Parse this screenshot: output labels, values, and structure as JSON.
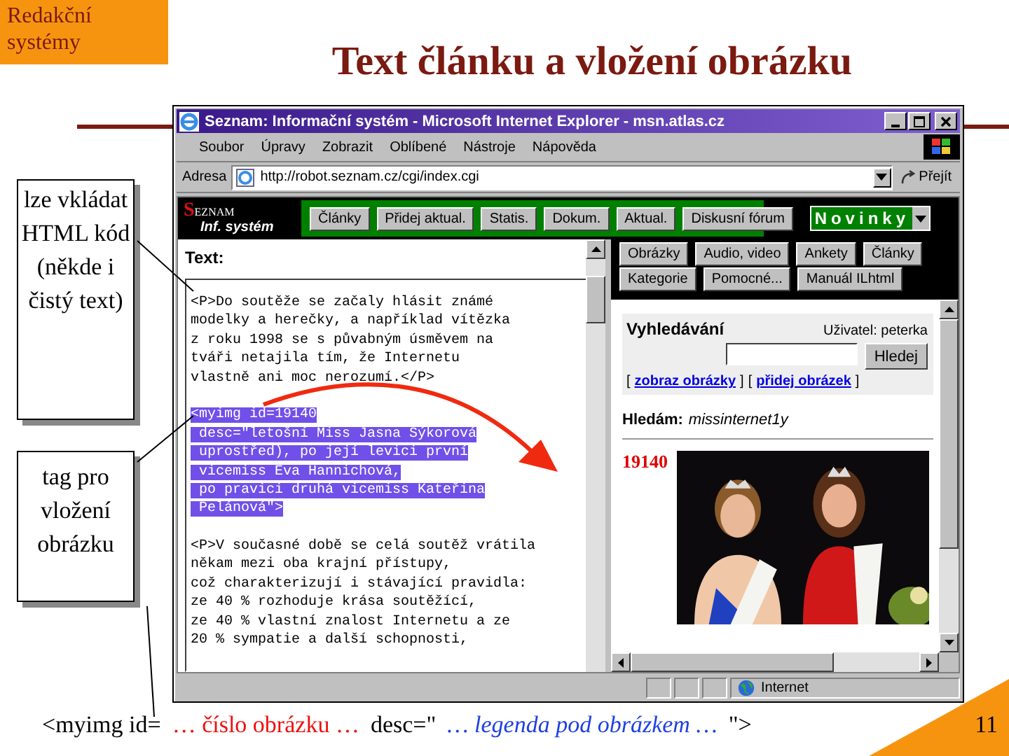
{
  "slide": {
    "corner_label": "Redakční systémy",
    "title": "Text článku a vložení obrázku",
    "page_number": "11"
  },
  "callouts": [
    {
      "text": "lze vkládat HTML kód (někde i čistý text)"
    },
    {
      "text": "tag pro vložení obrázku"
    }
  ],
  "browser": {
    "title": "Seznam: Informační systém - Microsoft Internet Explorer - msn.atlas.cz",
    "menu": [
      "Soubor",
      "Úpravy",
      "Zobrazit",
      "Oblíbené",
      "Nástroje",
      "Nápověda"
    ],
    "address_label": "Adresa",
    "address": "http://robot.seznam.cz/cgi/index.cgi",
    "go_button": "Přejít",
    "status": "Internet"
  },
  "site": {
    "logo_initial": "S",
    "logo_rest": "EZNAM",
    "logo_subtitle": "Inf. systém",
    "nav": [
      "Články",
      "Přidej aktual.",
      "Statis.",
      "Dokum.",
      "Aktual.",
      "Diskusní fórum"
    ],
    "section_select": "Novinky",
    "text_label": "Text:",
    "paragraphs": [
      {
        "highlighted": false,
        "lines": [
          "<P>Do soutěže se začaly hlásit známé",
          "modelky a herečky, a například vítězka",
          "z roku 1998 se s půvabným úsměvem na",
          "tváři netajila tím, že Internetu",
          "vlastně ani moc nerozumí.</P>"
        ]
      },
      {
        "highlighted": true,
        "lines": [
          "<myimg id=19140",
          " desc=\"letošní Miss Jasna Sýkorová",
          " uprostřed), po její levici první",
          " vicemiss Eva Hannichová,",
          " po pravici druhá vicemiss Kateřina",
          " Pelánová\">"
        ]
      },
      {
        "highlighted": false,
        "lines": [
          "<P>V současné době se celá soutěž vrátila",
          "někam mezi oba krajní přístupy,",
          "což charakterizují i stávající pravidla:",
          "ze 40 % rozhoduje krása soutěžící,",
          "ze 40 % vlastní znalost Internetu a ze",
          "20 % sympatie a další schopnosti,"
        ]
      }
    ],
    "tool_buttons": [
      [
        "Obrázky",
        "Audio, video",
        "Ankety",
        "Články"
      ],
      [
        "Kategorie",
        "Pomocné...",
        "Manuál ILhtml"
      ]
    ],
    "search": {
      "title": "Vyhledávání",
      "user": "Uživatel: peterka",
      "button": "Hledej",
      "links": [
        {
          "open": "[",
          "label": "zobraz obrázky",
          "close": "]"
        },
        {
          "open": "[",
          "label": "přidej obrázek",
          "close": "]"
        }
      ]
    },
    "query_label": "Hledám:",
    "query": "missinternet1y",
    "image_id": "19140",
    "image": {
      "kind": "picture"
    }
  },
  "footer": [
    {
      "text": "<myimg id=",
      "kind": "code"
    },
    {
      "text": "… číslo obrázku …",
      "kind": "id-hint"
    },
    {
      "text": "desc=\"",
      "kind": "code"
    },
    {
      "text": "… legenda pod obrázkem …",
      "kind": "desc-hint"
    },
    {
      "text": "\">",
      "kind": "code"
    }
  ]
}
